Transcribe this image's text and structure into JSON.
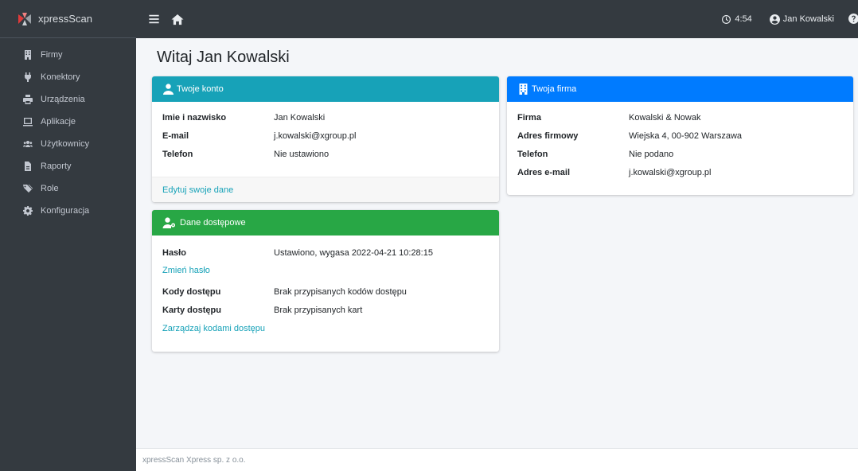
{
  "brand": {
    "name": "xpressScan"
  },
  "sidebar": {
    "items": [
      {
        "label": "Firmy",
        "icon": "building-icon"
      },
      {
        "label": "Konektory",
        "icon": "plug-icon"
      },
      {
        "label": "Urządzenia",
        "icon": "printer-icon"
      },
      {
        "label": "Aplikacje",
        "icon": "window-icon"
      },
      {
        "label": "Użytkownicy",
        "icon": "users-icon"
      },
      {
        "label": "Raporty",
        "icon": "report-icon"
      },
      {
        "label": "Role",
        "icon": "tags-icon"
      },
      {
        "label": "Konfiguracja",
        "icon": "gear-icon"
      }
    ]
  },
  "topbar": {
    "time": "4:54",
    "user": "Jan Kowalski"
  },
  "page": {
    "title": "Witaj Jan Kowalski"
  },
  "account_card": {
    "title": "Twoje konto",
    "rows": [
      {
        "k": "Imie i nazwisko",
        "v": "Jan Kowalski"
      },
      {
        "k": "E-mail",
        "v": "j.kowalski@xgroup.pl"
      },
      {
        "k": "Telefon",
        "v": "Nie ustawiono"
      }
    ],
    "edit_link": "Edytuj swoje dane"
  },
  "company_card": {
    "title": "Twoja firma",
    "rows": [
      {
        "k": "Firma",
        "v": "Kowalski & Nowak"
      },
      {
        "k": "Adres firmowy",
        "v": "Wiejska 4, 00-902 Warszawa"
      },
      {
        "k": "Telefon",
        "v": "Nie podano"
      },
      {
        "k": "Adres e-mail",
        "v": "j.kowalski@xgroup.pl"
      }
    ]
  },
  "access_card": {
    "title": "Dane dostępowe",
    "password_label": "Hasło",
    "password_value": "Ustawiono, wygasa 2022-04-21 10:28:15",
    "change_password_link": "Zmień hasło",
    "codes_label": "Kody dostępu",
    "codes_value": "Brak przypisanych kodów dostępu",
    "cards_label": "Karty dostępu",
    "cards_value": "Brak przypisanych kart",
    "manage_link": "Zarządzaj kodami dostępu"
  },
  "footer": {
    "text": "xpressScan Xpress sp. z o.o."
  },
  "colors": {
    "sidebar_bg": "#343a40",
    "teal": "#17a2b8",
    "blue": "#007bff",
    "green": "#28a745",
    "content_bg": "#f4f6f9"
  }
}
